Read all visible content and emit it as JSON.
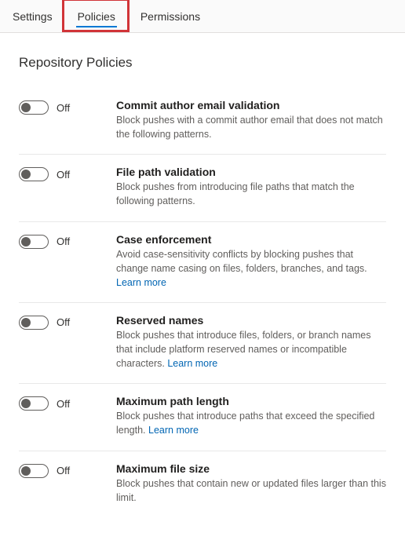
{
  "tabs": {
    "settings": "Settings",
    "policies": "Policies",
    "permissions": "Permissions",
    "active": "policies"
  },
  "page_title": "Repository Policies",
  "toggle_off_label": "Off",
  "learn_more": "Learn more",
  "policies": [
    {
      "key": "commit-author-email",
      "title": "Commit author email validation",
      "desc": "Block pushes with a commit author email that does not match the following patterns.",
      "learn_more": false,
      "on": false
    },
    {
      "key": "file-path-validation",
      "title": "File path validation",
      "desc": "Block pushes from introducing file paths that match the following patterns.",
      "learn_more": false,
      "on": false
    },
    {
      "key": "case-enforcement",
      "title": "Case enforcement",
      "desc": "Avoid case-sensitivity conflicts by blocking pushes that change name casing on files, folders, branches, and tags.",
      "learn_more": true,
      "on": false
    },
    {
      "key": "reserved-names",
      "title": "Reserved names",
      "desc": "Block pushes that introduce files, folders, or branch names that include platform reserved names or incompatible characters.",
      "learn_more": true,
      "on": false
    },
    {
      "key": "max-path-length",
      "title": "Maximum path length",
      "desc": "Block pushes that introduce paths that exceed the specified length.",
      "learn_more": true,
      "on": false
    },
    {
      "key": "max-file-size",
      "title": "Maximum file size",
      "desc": "Block pushes that contain new or updated files larger than this limit.",
      "learn_more": false,
      "on": false
    }
  ],
  "highlight": {
    "tab": "policies"
  }
}
